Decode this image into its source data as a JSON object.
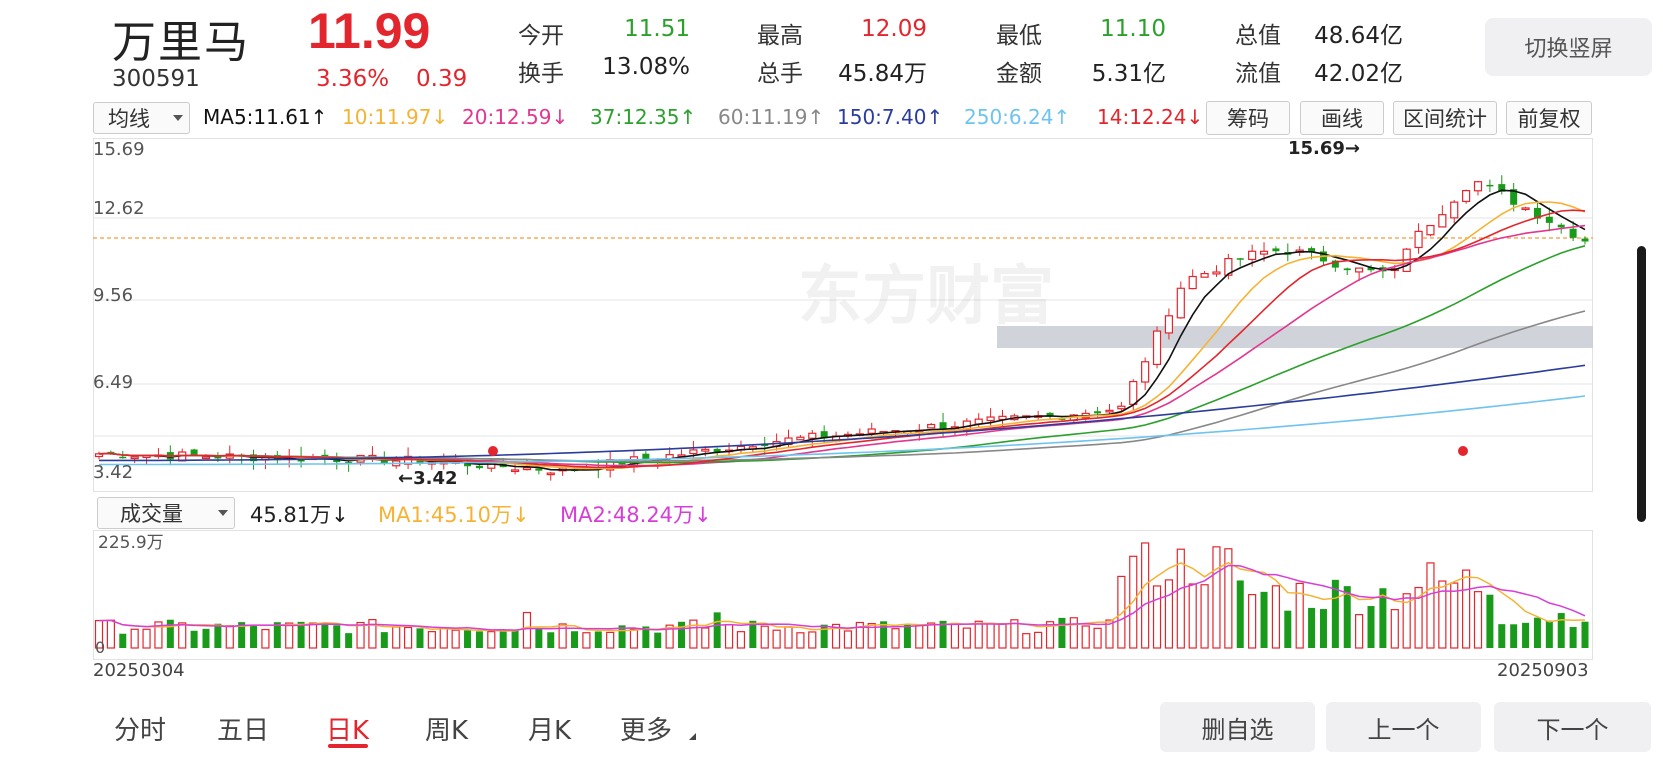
{
  "stock": {
    "name": "万里马",
    "code": "300591",
    "price": "11.99",
    "change_pct": "3.36%",
    "change_amt": "0.39"
  },
  "quotes": [
    {
      "label": "今开",
      "value": "11.51",
      "color": "#2ca02c"
    },
    {
      "label": "最高",
      "value": "12.09",
      "color": "#e3262d"
    },
    {
      "label": "最低",
      "value": "11.10",
      "color": "#2ca02c"
    },
    {
      "label": "总值",
      "value": "48.64亿",
      "color": "#333333"
    },
    {
      "label": "换手",
      "value": "13.08%",
      "color": "#333333"
    },
    {
      "label": "总手",
      "value": "45.84万",
      "color": "#333333"
    },
    {
      "label": "金额",
      "value": "5.31亿",
      "color": "#333333"
    },
    {
      "label": "流值",
      "value": "42.02亿",
      "color": "#333333"
    }
  ],
  "switch_button": "切换竖屏",
  "ma_selector": "均线",
  "ma_legend": [
    {
      "label": "MA5:11.61↑",
      "color": "#111111"
    },
    {
      "label": "10:11.97↓",
      "color": "#f5b335"
    },
    {
      "label": "20:12.59↓",
      "color": "#e2378f"
    },
    {
      "label": "37:12.35↑",
      "color": "#2ca02c"
    },
    {
      "label": "60:11.19↑",
      "color": "#888888"
    },
    {
      "label": "150:7.40↑",
      "color": "#2b3d9c"
    },
    {
      "label": "250:6.24↑",
      "color": "#6fc3ef"
    },
    {
      "label": "14:12.24↓",
      "color": "#e3262d"
    }
  ],
  "tools": [
    "筹码",
    "画线",
    "区间统计",
    "前复权"
  ],
  "price_axis": [
    "15.69",
    "12.62",
    "9.56",
    "6.49",
    "3.42"
  ],
  "annotations": {
    "high": "15.69→",
    "low": "←3.42"
  },
  "watermark": "东方财富",
  "volume": {
    "selector": "成交量",
    "current": "45.81万↓",
    "ma1": "MA1:45.10万↓",
    "ma2": "MA2:48.24万↓",
    "axis_max": "225.9万",
    "axis_zero": "0",
    "ma1_color": "#f5b335",
    "ma2_color": "#d63ed8"
  },
  "dates": {
    "start": "20250304",
    "end": "20250903"
  },
  "period_tabs": [
    "分时",
    "五日",
    "日K",
    "周K",
    "月K",
    "更多"
  ],
  "active_tab": "日K",
  "nav_buttons": [
    "删自选",
    "上一个",
    "下一个"
  ],
  "colors": {
    "up": "#e3262d",
    "down": "#1a9a1a"
  }
}
